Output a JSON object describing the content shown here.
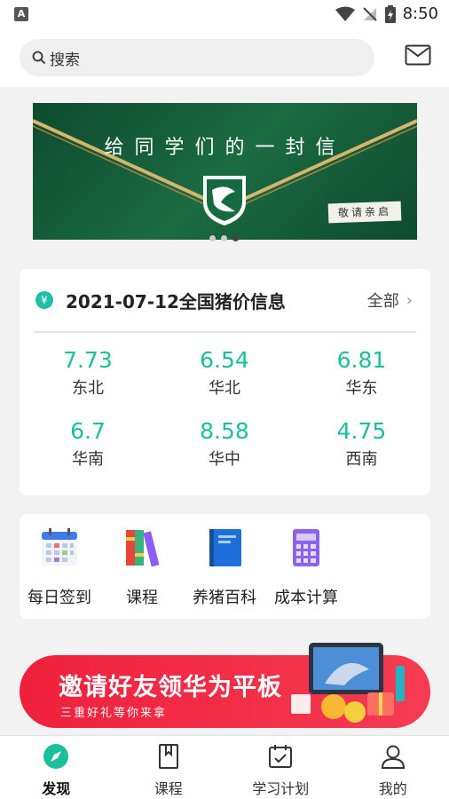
{
  "status_bar": {
    "time": "8:50",
    "indicator": "A"
  },
  "search": {
    "placeholder": "搜索"
  },
  "banner": {
    "title": "给同学们的一封信",
    "stamp": "敬请亲启",
    "page_count": 3,
    "active_index": 2
  },
  "price_card": {
    "title": "2021-07-12全国猪价信息",
    "all_label": "全部",
    "prices": [
      {
        "value": "7.73",
        "region": "东北"
      },
      {
        "value": "6.54",
        "region": "华北"
      },
      {
        "value": "6.81",
        "region": "华东"
      },
      {
        "value": "6.7",
        "region": "华南"
      },
      {
        "value": "8.58",
        "region": "华中"
      },
      {
        "value": "4.75",
        "region": "西南"
      }
    ]
  },
  "menu": [
    {
      "label": "每日签到",
      "icon": "calendar-icon"
    },
    {
      "label": "课程",
      "icon": "books-icon"
    },
    {
      "label": "养猪百科",
      "icon": "notebook-icon"
    },
    {
      "label": "成本计算",
      "icon": "calculator-icon"
    }
  ],
  "promo": {
    "title": "邀请好友领华为平板",
    "subtitle": "三重好礼等你来拿"
  },
  "tabs": [
    {
      "label": "发现",
      "icon": "discover-icon",
      "active": true
    },
    {
      "label": "课程",
      "icon": "bookmark-book-icon",
      "active": false
    },
    {
      "label": "学习计划",
      "icon": "study-plan-icon",
      "active": false
    },
    {
      "label": "我的",
      "icon": "profile-icon",
      "active": false
    }
  ],
  "colors": {
    "accent": "#1abf9b",
    "promo": "#f0203c",
    "banner": "#1b6b43"
  }
}
